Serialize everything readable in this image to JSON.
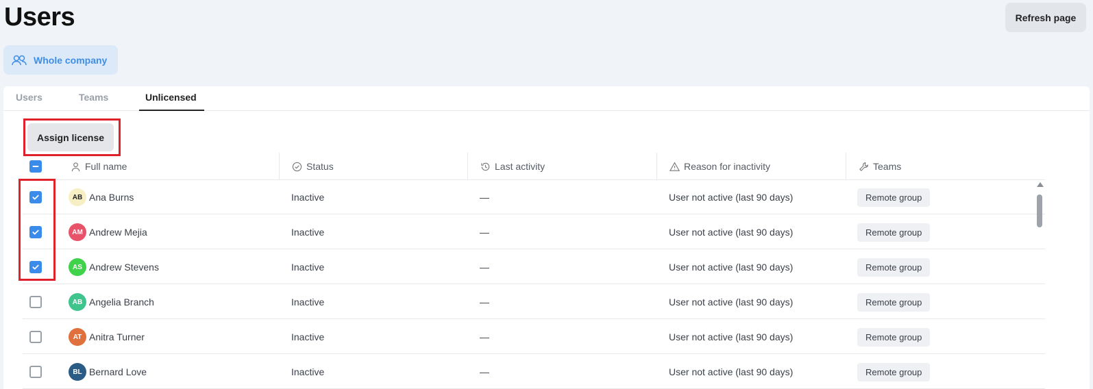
{
  "page": {
    "title": "Users",
    "refresh_label": "Refresh page"
  },
  "scope": {
    "label": "Whole company",
    "icon": "users-icon"
  },
  "tabs": [
    {
      "label": "Users",
      "active": false
    },
    {
      "label": "Teams",
      "active": false
    },
    {
      "label": "Unlicensed",
      "active": true
    }
  ],
  "actions": {
    "assign_label": "Assign license"
  },
  "columns": {
    "full_name": "Full name",
    "status": "Status",
    "last_activity": "Last activity",
    "reason": "Reason for inactivity",
    "teams": "Teams"
  },
  "rows": [
    {
      "checked": true,
      "initials": "AB",
      "avatar_color": "#f6efc4",
      "avatar_text": "#222",
      "name": "Ana Burns",
      "status": "Inactive",
      "last_activity": "—",
      "reason": "User not active (last 90 days)",
      "team": "Remote group"
    },
    {
      "checked": true,
      "initials": "AM",
      "avatar_color": "#e8536a",
      "avatar_text": "#fff",
      "name": "Andrew Mejia",
      "status": "Inactive",
      "last_activity": "—",
      "reason": "User not active (last 90 days)",
      "team": "Remote group"
    },
    {
      "checked": true,
      "initials": "AS",
      "avatar_color": "#3fd24a",
      "avatar_text": "#fff",
      "name": "Andrew Stevens",
      "status": "Inactive",
      "last_activity": "—",
      "reason": "User not active (last 90 days)",
      "team": "Remote group"
    },
    {
      "checked": false,
      "initials": "AB",
      "avatar_color": "#3ec48c",
      "avatar_text": "#fff",
      "name": "Angelia Branch",
      "status": "Inactive",
      "last_activity": "—",
      "reason": "User not active (last 90 days)",
      "team": "Remote group"
    },
    {
      "checked": false,
      "initials": "AT",
      "avatar_color": "#e0703c",
      "avatar_text": "#fff",
      "name": "Anitra Turner",
      "status": "Inactive",
      "last_activity": "—",
      "reason": "User not active (last 90 days)",
      "team": "Remote group"
    },
    {
      "checked": false,
      "initials": "BL",
      "avatar_color": "#2b5c86",
      "avatar_text": "#fff",
      "name": "Bernard Love",
      "status": "Inactive",
      "last_activity": "—",
      "reason": "User not active (last 90 days)",
      "team": "Remote group"
    }
  ],
  "colors": {
    "accent": "#3b8bea",
    "highlight": "#e0202a"
  }
}
